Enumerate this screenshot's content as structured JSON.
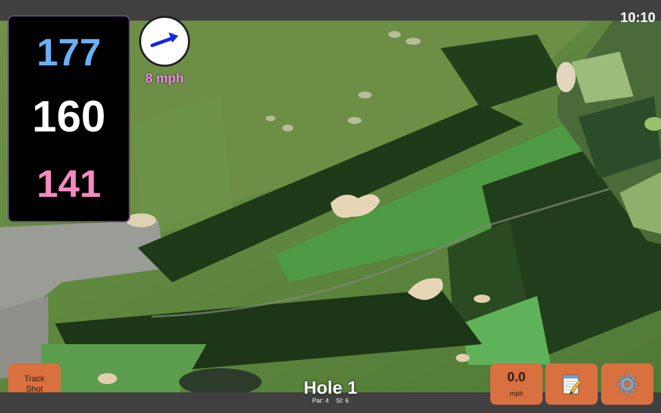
{
  "status": {
    "time": "10:10"
  },
  "distances": {
    "back": "177",
    "center": "160",
    "front": "141",
    "colors": {
      "back": "#6ab0f5",
      "center": "#ffffff",
      "front": "#f48ac0"
    }
  },
  "wind": {
    "speed": "8 mph",
    "direction": "east-northeast",
    "arrow_icon": "wind-arrow-icon",
    "speed_color": "#f08cf0"
  },
  "hole": {
    "title": "Hole 1",
    "par": "Par: 4",
    "si": "SI: 6"
  },
  "buttons": {
    "track_shot_line1": "Track",
    "track_shot_line2": "Shot",
    "speed_value": "0.0",
    "speed_unit": "mph",
    "notes_icon": "notepad-icon",
    "settings_icon": "gear-icon"
  },
  "theme": {
    "button_color": "#d9703f",
    "bar_color": "#404040",
    "panel_bg": "#000000"
  }
}
